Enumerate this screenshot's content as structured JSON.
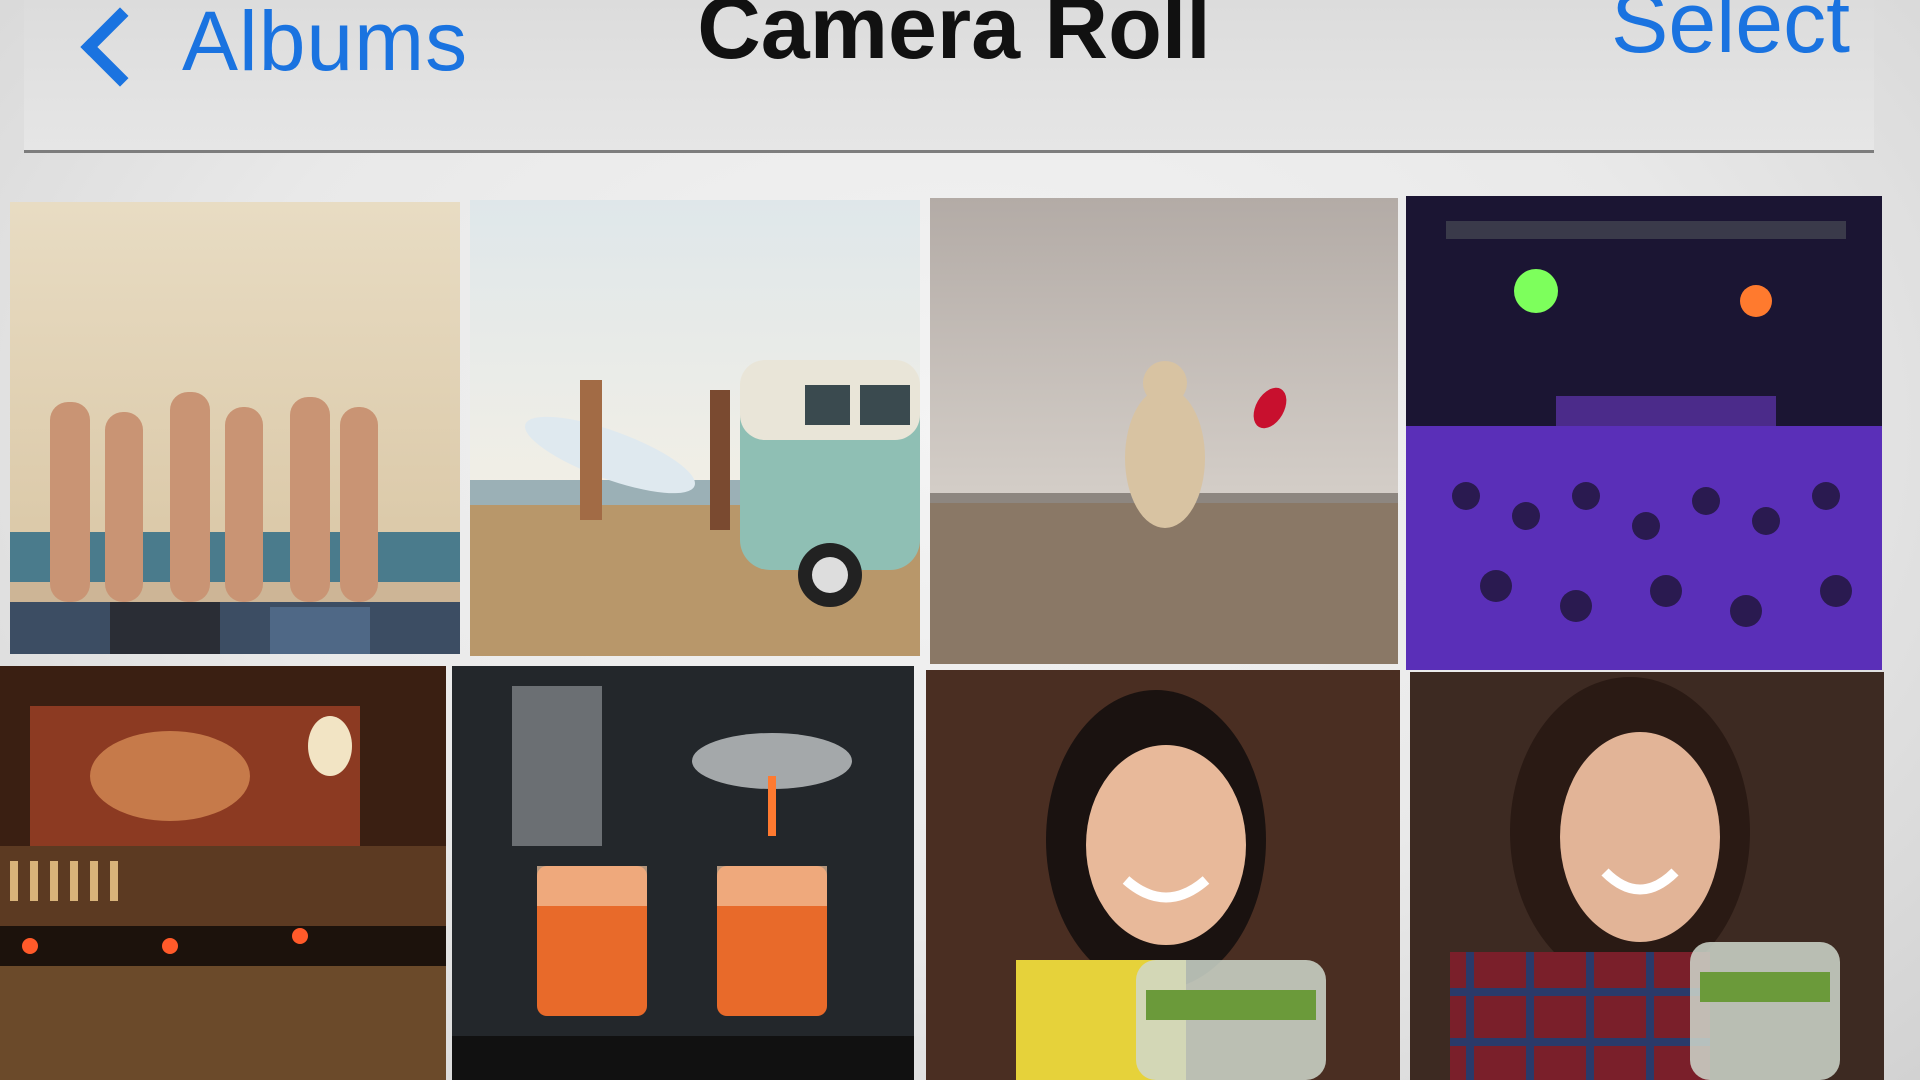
{
  "navbar": {
    "back_label": "Albums",
    "title": "Camera Roll",
    "select_label": "Select"
  },
  "accent_color": "#1a73e0",
  "photos": [
    {
      "subject": "friends lying on beach sand with feet up"
    },
    {
      "subject": "surfers with surfboard beside vintage van on beach"
    },
    {
      "subject": "dog jumping for red frisbee on beach"
    },
    {
      "subject": "crowd at concert with purple stage lights"
    },
    {
      "subject": "bar interior with mural and candles"
    },
    {
      "subject": "bartender straining orange cocktails"
    },
    {
      "subject": "smiling woman holding drink"
    },
    {
      "subject": "smiling woman in plaid shirt toasting"
    }
  ]
}
